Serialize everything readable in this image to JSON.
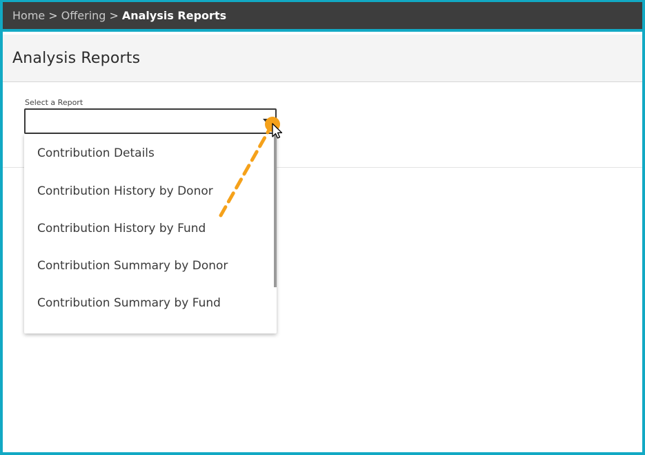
{
  "breadcrumb": {
    "items": [
      {
        "label": "Home"
      },
      {
        "label": "Offering"
      },
      {
        "label": "Analysis Reports"
      }
    ],
    "separator": ">"
  },
  "page": {
    "title": "Analysis Reports"
  },
  "report_select": {
    "label": "Select a Report",
    "value": "",
    "options": [
      "Contribution Details",
      "Contribution History by Donor",
      "Contribution History by Fund",
      "Contribution Summary by Donor",
      "Contribution Summary by Fund"
    ]
  },
  "colors": {
    "frame": "#12a9c4",
    "breadcrumb_bg": "#3d3d3d",
    "header_bg": "#f4f4f4",
    "annotation": "#f5a11a"
  },
  "icons": {
    "breadcrumb_separator": "chevron-right-icon",
    "select_arrow": "caret-down-icon",
    "cursor": "mouse-pointer-icon"
  }
}
